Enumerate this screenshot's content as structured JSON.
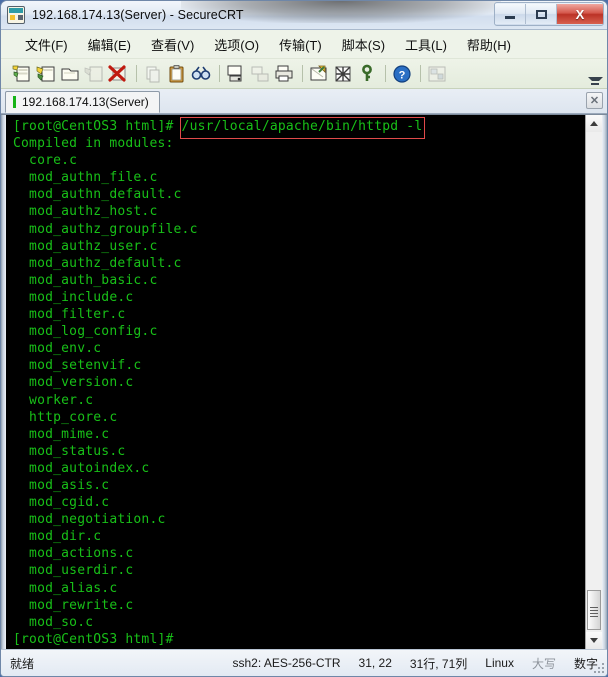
{
  "window": {
    "title": "192.168.174.13(Server) - SecureCRT",
    "icon": "securecrt-icon",
    "controls": {
      "minimize": "–",
      "maximize": "□",
      "close": "X"
    }
  },
  "menubar": {
    "items": [
      {
        "label": "文件(F)",
        "name": "menu-file"
      },
      {
        "label": "编辑(E)",
        "name": "menu-edit"
      },
      {
        "label": "查看(V)",
        "name": "menu-view"
      },
      {
        "label": "选项(O)",
        "name": "menu-options"
      },
      {
        "label": "传输(T)",
        "name": "menu-transfer"
      },
      {
        "label": "脚本(S)",
        "name": "menu-script"
      },
      {
        "label": "工具(L)",
        "name": "menu-tools"
      },
      {
        "label": "帮助(H)",
        "name": "menu-help"
      }
    ]
  },
  "toolbar": {
    "icons": [
      "new-session-icon",
      "connect-sftp-icon",
      "clone-session-icon",
      "disconnect-icon",
      "close-session-icon",
      "sep",
      "copy-icon",
      "paste-icon",
      "find-icon",
      "sep",
      "print-screen-icon",
      "log-session-icon",
      "print-icon",
      "sep",
      "session-options-icon",
      "global-options-icon",
      "key-icon",
      "sep",
      "help-icon",
      "sep",
      "arrange-icon"
    ],
    "overflow": "toolbar-overflow-chevron"
  },
  "tabbar": {
    "tabs": [
      {
        "label": "192.168.174.13(Server)",
        "active": true
      }
    ],
    "close_label": "✕"
  },
  "terminal": {
    "prompt": "[root@CentOS3 html]#",
    "command": "/usr/local/apache/bin/httpd -l",
    "highlight_color": "#e04a4a",
    "text_color": "#18c018",
    "background": "#000000",
    "lines": [
      "[root@CentOS3 html]# /usr/local/apache/bin/httpd -l",
      "Compiled in modules:",
      "  core.c",
      "  mod_authn_file.c",
      "  mod_authn_default.c",
      "  mod_authz_host.c",
      "  mod_authz_groupfile.c",
      "  mod_authz_user.c",
      "  mod_authz_default.c",
      "  mod_auth_basic.c",
      "  mod_include.c",
      "  mod_filter.c",
      "  mod_log_config.c",
      "  mod_env.c",
      "  mod_setenvif.c",
      "  mod_version.c",
      "  worker.c",
      "  http_core.c",
      "  mod_mime.c",
      "  mod_status.c",
      "  mod_autoindex.c",
      "  mod_asis.c",
      "  mod_cgid.c",
      "  mod_negotiation.c",
      "  mod_dir.c",
      "  mod_actions.c",
      "  mod_userdir.c",
      "  mod_alias.c",
      "  mod_rewrite.c",
      "  mod_so.c",
      "[root@CentOS3 html]#"
    ]
  },
  "statusbar": {
    "ready": "就绪",
    "encryption": "ssh2: AES-256-CTR",
    "cursor": "31, 22",
    "size": "31行, 71列",
    "emulation": "Linux",
    "caps": "大写",
    "num": "数字"
  }
}
